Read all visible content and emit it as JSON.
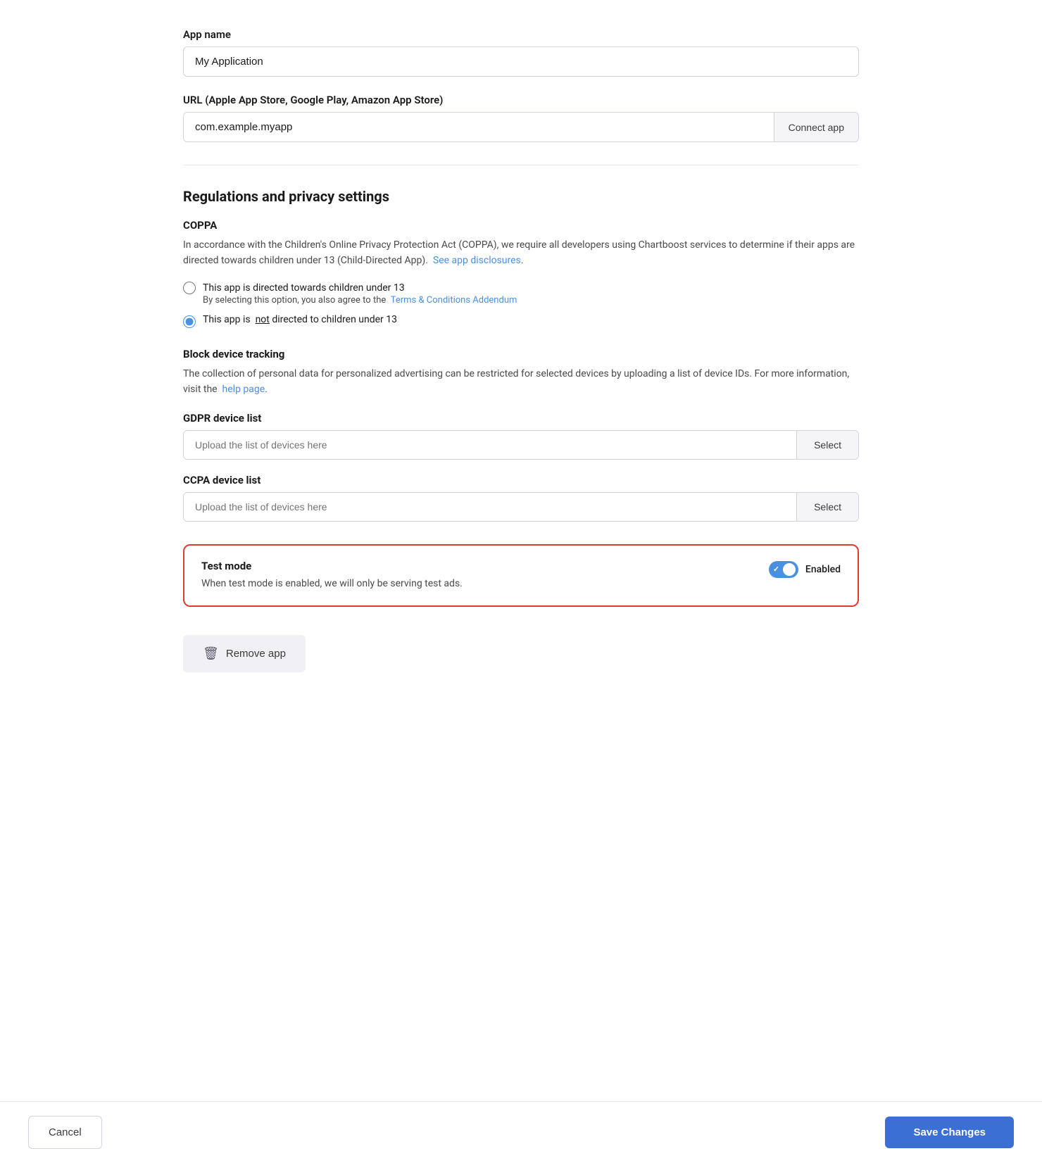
{
  "app_name": {
    "label": "App name",
    "value": "My Application",
    "placeholder": "My Application"
  },
  "url": {
    "label": "URL (Apple App Store, Google Play, Amazon App Store)",
    "value": "com.example.myapp",
    "placeholder": "com.example.myapp",
    "connect_button": "Connect app"
  },
  "regulations": {
    "title": "Regulations and privacy settings",
    "coppa": {
      "title": "COPPA",
      "description": "In accordance with the Children's Online Privacy Protection Act (COPPA), we require all developers using Chartboost services to determine if their apps are directed towards children under 13 (Child-Directed App).",
      "link_text": "See app disclosures",
      "option1_label": "This app is directed towards children under 13",
      "option1_sublabel": "By selecting this option, you also agree to the",
      "terms_link": "Terms & Conditions Addendum",
      "option2_label": "This app is",
      "option2_not": "not",
      "option2_label2": "directed to children under 13"
    },
    "block_tracking": {
      "title": "Block device tracking",
      "description": "The collection of personal data for personalized advertising can be restricted for selected devices by uploading a list of device IDs. For more information, visit the",
      "link_text": "help page"
    },
    "gdpr": {
      "title": "GDPR device list",
      "placeholder": "Upload the list of devices here",
      "select_button": "Select"
    },
    "ccpa": {
      "title": "CCPA device list",
      "placeholder": "Upload the list of devices here",
      "select_button": "Select"
    }
  },
  "test_mode": {
    "title": "Test mode",
    "description": "When test mode is enabled, we will only be serving test ads.",
    "toggle_label": "Enabled",
    "enabled": true
  },
  "remove_app": {
    "button_label": "Remove app"
  },
  "footer": {
    "cancel_label": "Cancel",
    "save_label": "Save Changes"
  }
}
